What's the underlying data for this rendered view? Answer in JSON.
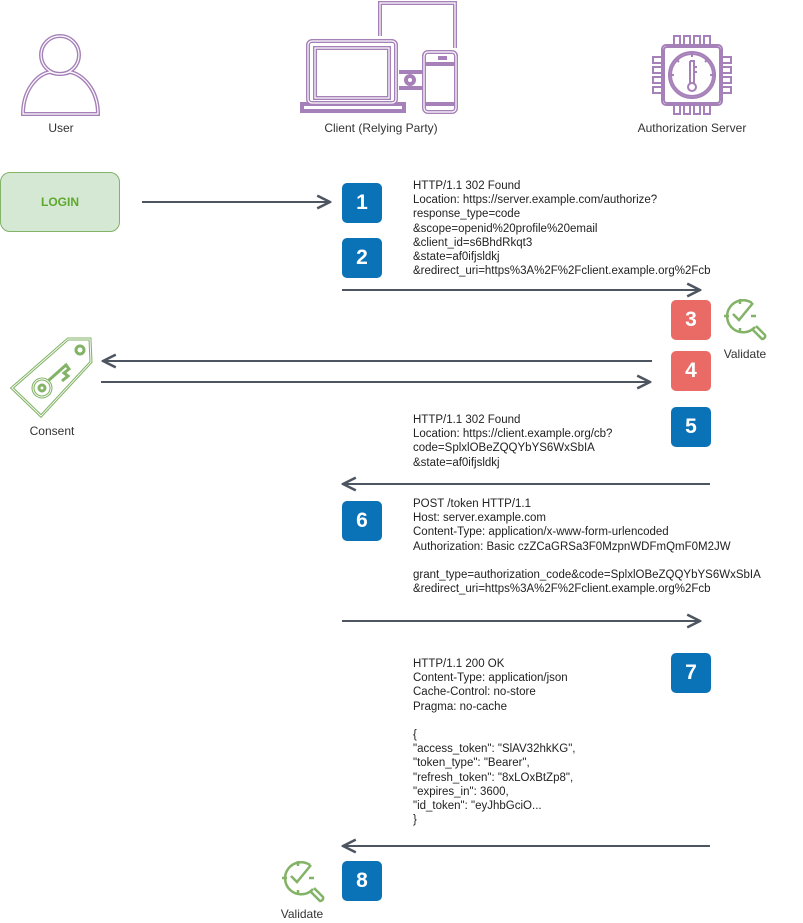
{
  "actors": {
    "user": "User",
    "client": "Client (Relying Party)",
    "server": "Authorization Server"
  },
  "login_button": "LOGIN",
  "consent_label": "Consent",
  "validate_labels": [
    "Validate",
    "Validate"
  ],
  "colors": {
    "actor_icon": "#a680b8",
    "green_icon": "#82b366",
    "badge_blue": "#0a73b8",
    "badge_red": "#ea6b66",
    "arrow": "#4d5560"
  },
  "steps": [
    "1",
    "2",
    "3",
    "4",
    "5",
    "6",
    "7",
    "8"
  ],
  "messages": {
    "authorize_request": "HTTP/1.1 302 Found\nLocation: https://server.example.com/authorize?\nresponse_type=code\n&scope=openid%20profile%20email\n&client_id=s6BhdRkqt3\n&state=af0ifjsldkj\n&redirect_uri=https%3A%2F%2Fclient.example.org%2Fcb",
    "callback": "HTTP/1.1 302 Found\nLocation: https://client.example.org/cb?\ncode=SplxlOBeZQQYbYS6WxSbIA\n&state=af0ifjsldkj",
    "token_request": "POST /token HTTP/1.1\nHost: server.example.com\nContent-Type: application/x-www-form-urlencoded\nAuthorization: Basic czZCaGRSa3F0MzpnWDFmQmF0M2JW\n\ngrant_type=authorization_code&code=SplxlOBeZQQYbYS6WxSbIA\n&redirect_uri=https%3A%2F%2Fclient.example.org%2Fcb",
    "token_response": "HTTP/1.1 200 OK\nContent-Type: application/json\nCache-Control: no-store\nPragma: no-cache\n\n{\n\"access_token\": \"SlAV32hkKG\",\n\"token_type\": \"Bearer\",\n\"refresh_token\": \"8xLOxBtZp8\",\n\"expires_in\": 3600,\n\"id_token\": \"eyJhbGciO...\n}"
  }
}
